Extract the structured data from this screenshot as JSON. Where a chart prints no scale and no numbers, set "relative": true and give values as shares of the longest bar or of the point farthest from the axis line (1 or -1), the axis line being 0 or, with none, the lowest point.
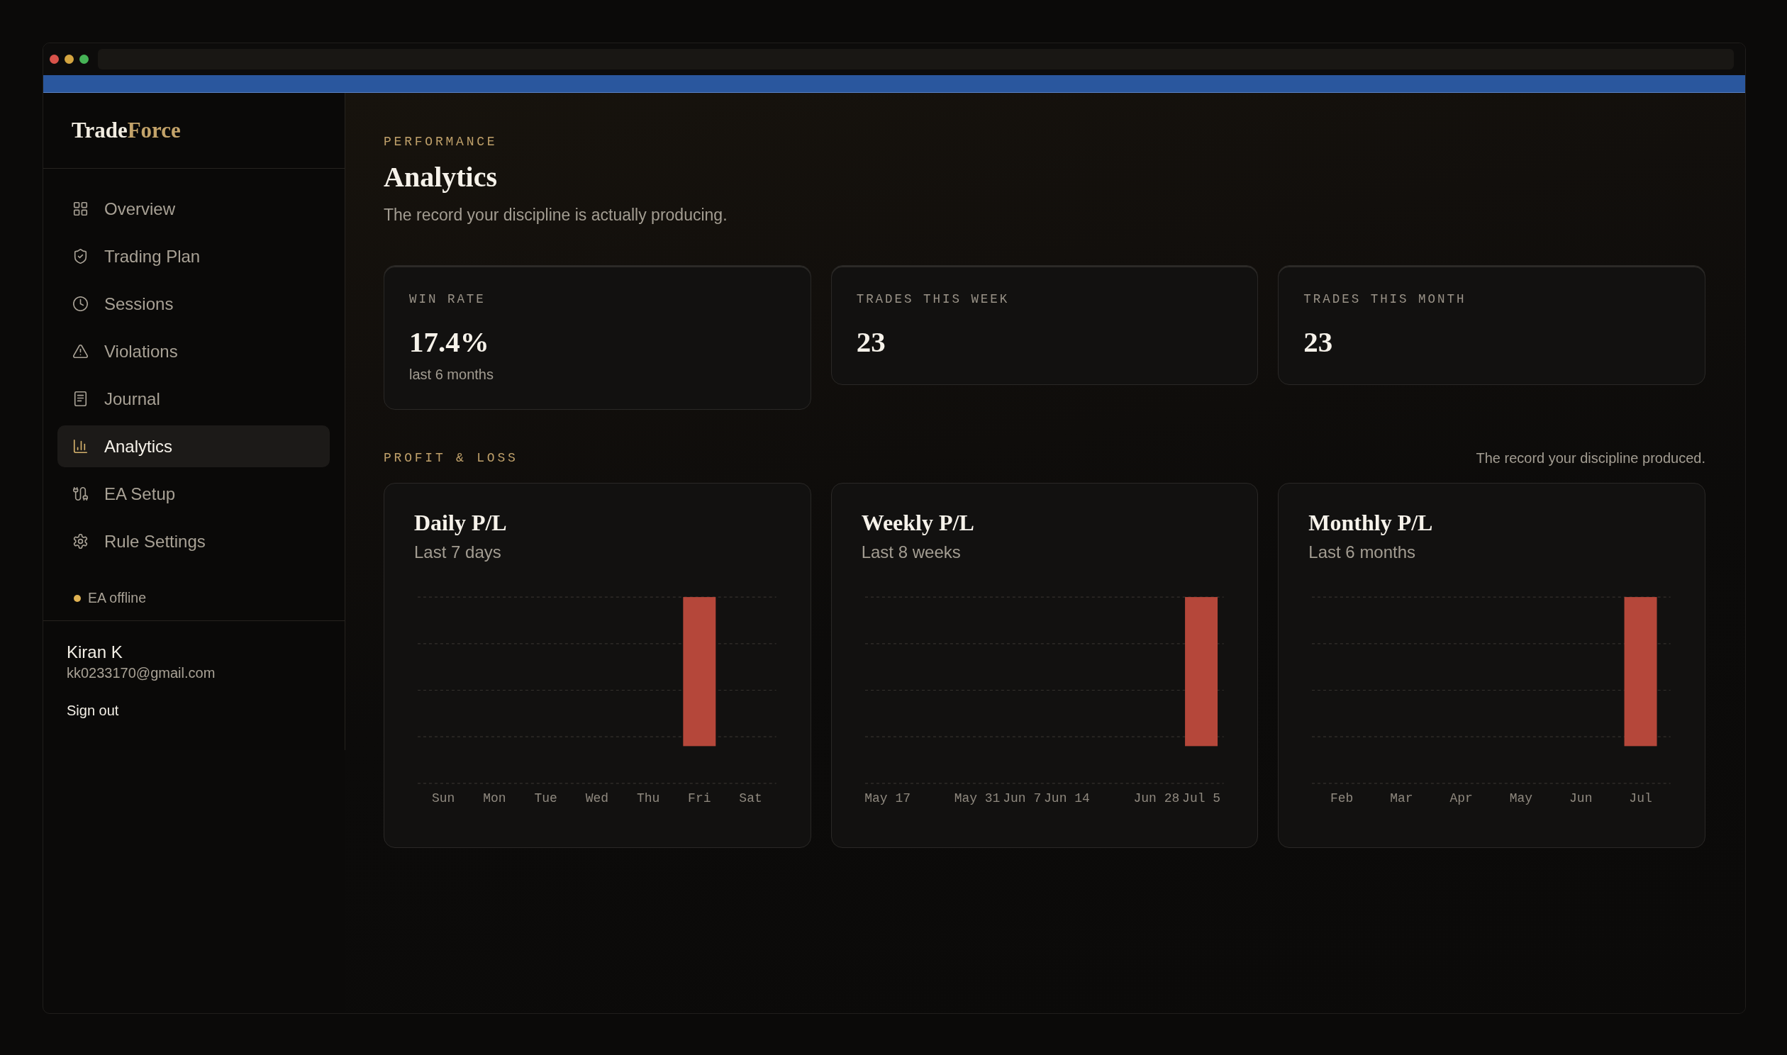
{
  "sidebar": {
    "brand": [
      {
        "text": "Trade",
        "kind": "plain"
      },
      {
        "text": "Force",
        "kind": "accent"
      }
    ],
    "nav": [
      {
        "label": "Overview",
        "selected": false
      },
      {
        "label": "Trading Plan",
        "selected": false
      },
      {
        "label": "Sessions",
        "selected": false
      },
      {
        "label": "Violations",
        "selected": false
      },
      {
        "label": "Journal",
        "selected": false
      },
      {
        "label": "Analytics",
        "selected": true
      },
      {
        "label": "EA Setup",
        "selected": false
      },
      {
        "label": "Rule Settings",
        "selected": false
      }
    ],
    "status": {
      "label": "EA offline",
      "color": "#e0b252"
    },
    "user": {
      "name": "Kiran K",
      "email": "kk0233170@gmail.com",
      "sign_out": "Sign out"
    }
  },
  "header": {
    "eyebrow": "PERFORMANCE",
    "title": "Analytics",
    "subtitle": "The record your discipline is actually producing."
  },
  "stats": [
    {
      "label": "WIN RATE",
      "value": "17.4%",
      "note": "last 6 months"
    },
    {
      "label": "TRADES THIS WEEK",
      "value": "23"
    },
    {
      "label": "TRADES THIS MONTH",
      "value": "23"
    }
  ],
  "pnl": {
    "eyebrow": "PROFIT & LOSS",
    "caption": "The record your discipline produced.",
    "charts": [
      {
        "title": "Daily P/L",
        "subtitle": "Last 7 days",
        "chart_data": {
          "type": "bar",
          "relative": true,
          "categories": [
            "Sun",
            "Mon",
            "Tue",
            "Wed",
            "Thu",
            "Fri",
            "Sat"
          ],
          "values": [
            0,
            0,
            0,
            0,
            0,
            -1,
            0
          ]
        }
      },
      {
        "title": "Weekly P/L",
        "subtitle": "Last 8 weeks",
        "chart_data": {
          "type": "bar",
          "relative": true,
          "categories": [
            "May 17",
            null,
            "May 31",
            "Jun 7",
            "Jun 14",
            null,
            "Jun 28",
            "Jul 5"
          ],
          "values": [
            0,
            0,
            0,
            0,
            0,
            0,
            0,
            -1
          ]
        }
      },
      {
        "title": "Monthly P/L",
        "subtitle": "Last 6 months",
        "chart_data": {
          "type": "bar",
          "relative": true,
          "categories": [
            "Feb",
            "Mar",
            "Apr",
            "May",
            "Jun",
            "Jul"
          ],
          "values": [
            0,
            0,
            0,
            0,
            0,
            -1
          ]
        }
      }
    ]
  }
}
